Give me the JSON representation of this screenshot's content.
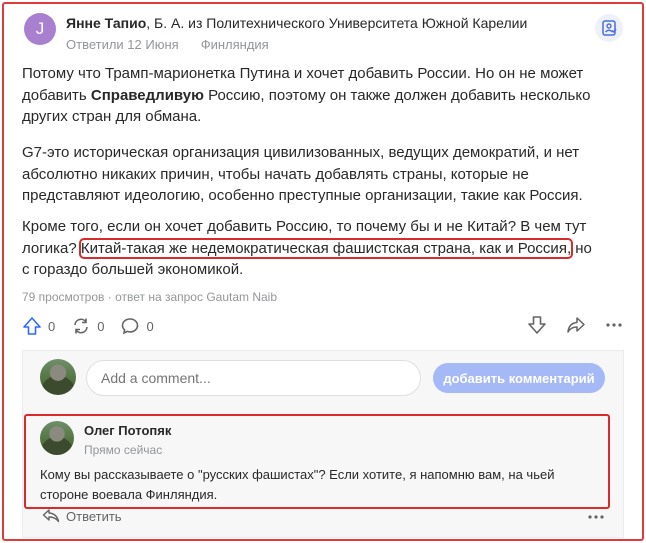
{
  "answer": {
    "avatar_letter": "J",
    "author_name": "Янне Тапио",
    "author_credential": ", Б. А. из Политехнического Университета Южной Карелии",
    "answered_date": "Ответили 12 Июня",
    "location": "Финляндия",
    "p1_a": "Потому что Трамп-марионетка Путина и хочет добавить России. Но он не может добавить ",
    "p1_bold": "Справедливую",
    "p1_b": " Россию, поэтому он также должен добавить несколько других стран для обмана.",
    "p2": "G7-это историческая организация цивилизованных, ведущих демократий, и нет абсолютно никаких причин, чтобы начать добавлять страны, которые не представляют идеологию, особенно преступные организации, такие как Россия.",
    "p3_a": "Кроме того, если он хочет добавить Россию, то почему бы и не Китай? В чем тут логика? ",
    "p3_highlight": "Китай-такая же недемократическая фашистская страна, как и Россия,",
    "p3_b": " но с гораздо большей экономикой.",
    "stats": "79 просмотров · ответ на запрос Gautam Naib",
    "upvotes": "0",
    "shares": "0",
    "comments": "0"
  },
  "comment_input": {
    "placeholder": "Add a comment...",
    "button_label": "добавить комментарий"
  },
  "comment": {
    "author": "Олег Потопяк",
    "time": "Прямо сейчас",
    "text": "Кому вы рассказываете о \"русских фашистах\"? Если хотите, я напомню вам, на чьей стороне воевала Финляндия.",
    "reply_label": "Ответить"
  },
  "colors": {
    "highlight_border": "#d92b2b",
    "button_bg": "#a6b9f7",
    "avatar_bg": "#a97fcf"
  },
  "icons": [
    "upvote-icon",
    "reshare-icon",
    "comment-icon",
    "downvote-icon",
    "share-icon",
    "more-icon",
    "bookmark-icon",
    "reply-icon"
  ]
}
